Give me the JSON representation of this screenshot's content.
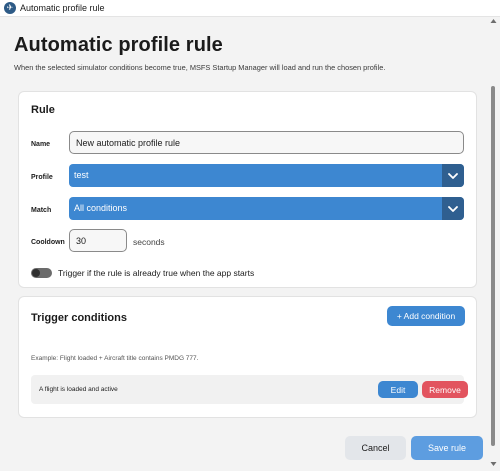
{
  "window": {
    "title": "Automatic profile rule",
    "icon": "app-logo-icon"
  },
  "header": {
    "title": "Automatic profile rule",
    "subtitle": "When the selected simulator conditions become true, MSFS Startup Manager will load and run the chosen profile."
  },
  "rule": {
    "section_title": "Rule",
    "name_label": "Name",
    "name_value": "New automatic profile rule",
    "profile_label": "Profile",
    "profile_value": "test",
    "match_label": "Match",
    "match_value": "All conditions",
    "cooldown_label": "Cooldown",
    "cooldown_value": "30",
    "cooldown_unit": "seconds",
    "trigger_if_true_label": "Trigger if the rule is already true when the app starts",
    "trigger_if_true_on": false
  },
  "trigger": {
    "section_title": "Trigger conditions",
    "add_label": "+ Add condition",
    "example": "Example: Flight loaded + Aircraft title contains PMDG 777.",
    "conditions": [
      {
        "text": "A flight is loaded and active",
        "edit_label": "Edit",
        "remove_label": "Remove"
      }
    ]
  },
  "footer": {
    "cancel_label": "Cancel",
    "save_label": "Save rule"
  },
  "colors": {
    "accent": "#3d87d1",
    "accent_dark": "#2f5f90",
    "danger": "#e2545f",
    "save_button": "#5d9de0"
  }
}
